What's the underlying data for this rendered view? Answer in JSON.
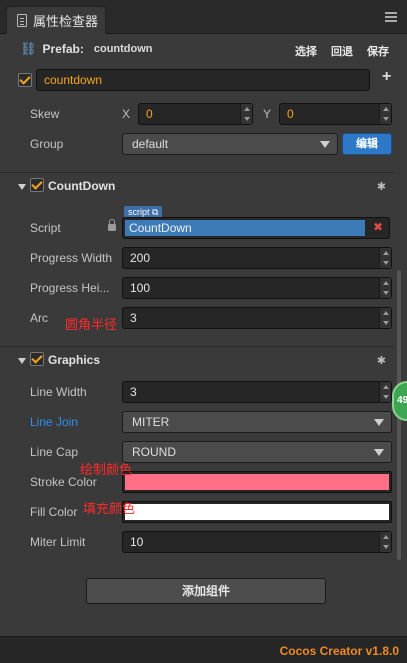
{
  "panel": {
    "tab_label": "属性检查器"
  },
  "prefab": {
    "label": "Prefab:",
    "name": "countdown",
    "actions": [
      "选择",
      "回退",
      "保存"
    ]
  },
  "node": {
    "enabled": true,
    "name": "countdown",
    "skew": {
      "label": "Skew",
      "x_label": "X",
      "x": "0",
      "y_label": "Y",
      "y": "0"
    },
    "group": {
      "label": "Group",
      "value": "default",
      "edit_label": "编辑"
    }
  },
  "countdown_component": {
    "title": "CountDown",
    "enabled": true,
    "script": {
      "label": "Script",
      "tag": "script",
      "value": "CountDown",
      "remove": "✖"
    },
    "progress_width": {
      "label": "Progress Width",
      "value": "200"
    },
    "progress_height": {
      "label": "Progress Hei...",
      "value": "100"
    },
    "arc": {
      "label": "Arc",
      "value": "3",
      "annotation": "圆角半径"
    }
  },
  "graphics_component": {
    "title": "Graphics",
    "enabled": true,
    "line_width": {
      "label": "Line Width",
      "value": "3"
    },
    "line_join": {
      "label": "Line Join",
      "value": "MITER"
    },
    "line_cap": {
      "label": "Line Cap",
      "value": "ROUND"
    },
    "stroke_color": {
      "label": "Stroke Color",
      "color": "#ff6f86",
      "annotation": "绘制颜色"
    },
    "fill_color": {
      "label": "Fill Color",
      "color": "#ffffff",
      "annotation": "填充颜色"
    },
    "miter_limit": {
      "label": "Miter Limit",
      "value": "10"
    }
  },
  "add_component_label": "添加组件",
  "badge_text": "49",
  "footer": {
    "version": "Cocos Creator v1.8.0"
  },
  "colors": {
    "accent": "#f5a623",
    "link": "#2f8ff0",
    "edit_button": "#2e78c8",
    "version": "#f08a24"
  }
}
